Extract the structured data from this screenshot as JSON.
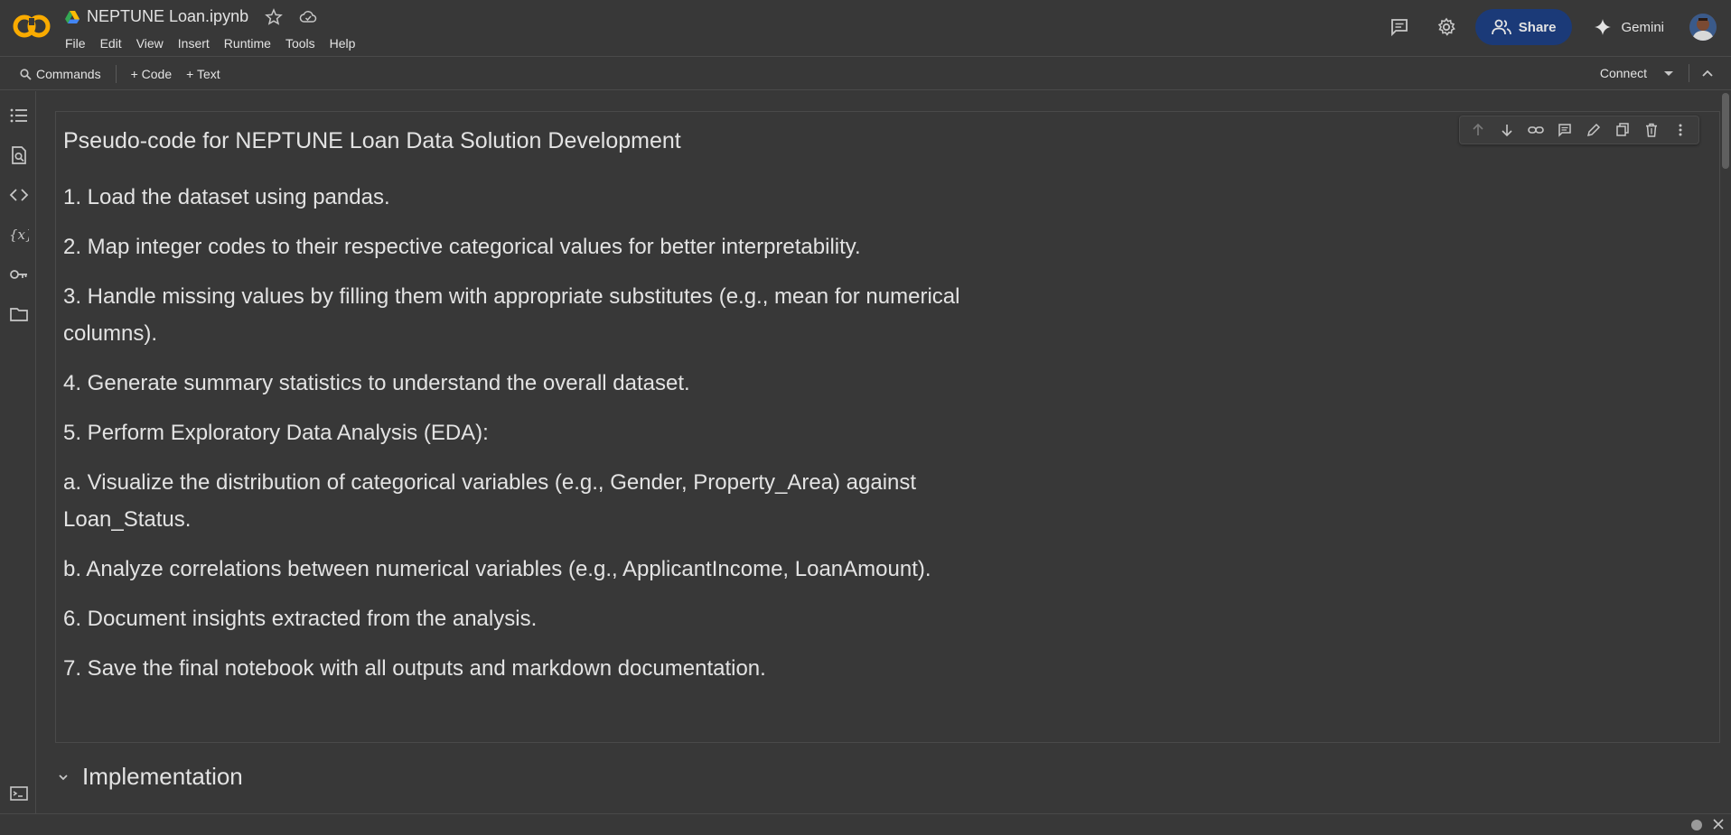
{
  "app": {
    "notebook_title": "NEPTUNE Loan.ipynb",
    "logo_text": "CO"
  },
  "menu": [
    "File",
    "Edit",
    "View",
    "Insert",
    "Runtime",
    "Tools",
    "Help"
  ],
  "header_actions": {
    "share_label": "Share",
    "gemini_label": "Gemini"
  },
  "toolbar": {
    "commands_label": "Commands",
    "code_label": "+ Code",
    "text_label": "+ Text",
    "connect_label": "Connect"
  },
  "sidebar_icons": [
    "table-of-contents-icon",
    "find-replace-icon",
    "code-snippets-icon",
    "variables-icon",
    "secrets-key-icon",
    "files-folder-icon"
  ],
  "cell": {
    "heading": "Pseudo-code for NEPTUNE Loan Data Solution Development",
    "lines": [
      "1. Load the dataset using pandas.",
      "2. Map integer codes to their respective categorical values for better interpretability.",
      "3. Handle missing values by filling them with appropriate substitutes (e.g., mean for numerical columns).",
      "4. Generate summary statistics to understand the overall dataset.",
      "5. Perform Exploratory Data Analysis (EDA):",
      "a. Visualize the distribution of categorical variables (e.g., Gender, Property_Area) against Loan_Status.",
      "b. Analyze correlations between numerical variables (e.g., ApplicantIncome, LoanAmount).",
      "6. Document insights extracted from the analysis.",
      "7. Save the final notebook with all outputs and markdown documentation."
    ]
  },
  "section": {
    "title": "Implementation"
  },
  "colors": {
    "background": "#383838",
    "share_bg": "#1b3a78",
    "logo_orange": "#f9ab00",
    "text": "#e3e3e3"
  }
}
